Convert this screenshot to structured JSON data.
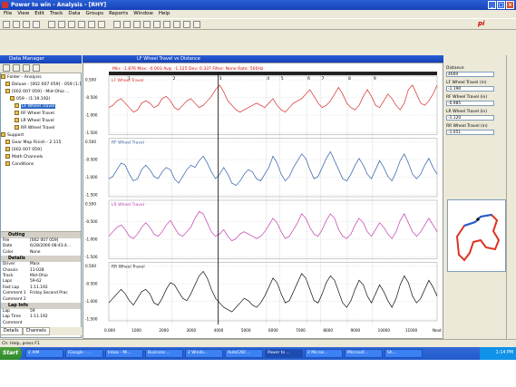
{
  "app": {
    "title": "Power to win - Analysis - [RHY]",
    "menu": [
      "File",
      "View",
      "Edit",
      "Track",
      "Data",
      "Groups",
      "Reports",
      "Window",
      "Help"
    ],
    "logo_text": "pi"
  },
  "data_manager": {
    "title": "Data Manager",
    "tree": [
      {
        "label": "Folder - Analysis",
        "indent": 0
      },
      {
        "label": "Deluxe - [002 007 059] - 059 (1:19.9...",
        "indent": 1
      },
      {
        "label": "[002 007 059] - Mid-Ohio ...",
        "indent": 1
      },
      {
        "label": "059 - (1:19.192)",
        "indent": 2
      },
      {
        "label": "LF Wheel Travel",
        "indent": 3,
        "selected": true
      },
      {
        "label": "RF Wheel Travel",
        "indent": 3
      },
      {
        "label": "LR Wheel Travel",
        "indent": 3
      },
      {
        "label": "RR Wheel Travel",
        "indent": 3
      },
      {
        "label": "Support",
        "indent": 0
      },
      {
        "label": "Gear Map Finish - 2.115",
        "indent": 1
      },
      {
        "label": "[002 007 059]",
        "indent": 1
      },
      {
        "label": "Math Channels",
        "indent": 1
      },
      {
        "label": "Conditions",
        "indent": 1
      }
    ],
    "sections": [
      {
        "title": "Outing",
        "rows": [
          {
            "k": "File",
            "v": "[002 007 059]"
          },
          {
            "k": "Date",
            "v": "6/28/2000 08:43:4..."
          },
          {
            "k": "Color",
            "v": "None"
          }
        ]
      },
      {
        "title": "Details",
        "rows": [
          {
            "k": "Driver",
            "v": "Marx"
          },
          {
            "k": "Chassis",
            "v": "11-028"
          },
          {
            "k": "Track",
            "v": "Mid-Ohio"
          },
          {
            "k": "Laps",
            "v": "59-62"
          },
          {
            "k": "Fast Lap",
            "v": "1:11.192"
          },
          {
            "k": "Comment 1",
            "v": "Friday Second Prac"
          },
          {
            "k": "Comment 2",
            "v": ""
          }
        ]
      },
      {
        "title": "Lap Info",
        "rows": [
          {
            "k": "Lap",
            "v": "59"
          },
          {
            "k": "Lap Time",
            "v": "1:11.192"
          },
          {
            "k": "Comment",
            "v": ""
          }
        ]
      }
    ],
    "tabs": [
      "Details",
      "Channels"
    ]
  },
  "chart_window": {
    "title": "LF Wheel Travel vs Distance",
    "stats_line": "Min: -1.876  Max: -0.003  Avg: -1.125  Dev: 0.337  Filter: None  Rate: 500Hz"
  },
  "chart_data": {
    "type": "line",
    "x_ticks": [
      "0.000",
      "1000",
      "2000",
      "3000",
      "4000",
      "5000",
      "6000",
      "7000",
      "8000",
      "9000",
      "10000",
      "11000",
      "Next"
    ],
    "xlim": [
      0,
      11700
    ],
    "segment_markers": [
      "1",
      "2",
      "3",
      "4",
      "5",
      "6",
      "7",
      "8",
      "9"
    ],
    "segment_positions": [
      650,
      2250,
      3900,
      5600,
      6100,
      7050,
      7550,
      8500,
      9400
    ],
    "cursor_x": 3900,
    "panels": [
      {
        "label": "LF Wheel Travel",
        "color": "#d62b2b",
        "ticks": [
          "0.500",
          "-0.500",
          "-1.000",
          "-1.500"
        ],
        "ylim": [
          -1.6,
          -0.3
        ],
        "values": [
          -1.0,
          -0.95,
          -0.85,
          -0.8,
          -0.9,
          -1.0,
          -1.1,
          -1.05,
          -0.9,
          -0.85,
          -0.9,
          -1.0,
          -0.95,
          -0.8,
          -0.75,
          -0.85,
          -1.0,
          -1.05,
          -0.95,
          -0.85,
          -0.8,
          -0.9,
          -1.0,
          -0.95,
          -0.85,
          -0.75,
          -0.6,
          -0.5,
          -0.65,
          -0.85,
          -0.95,
          -1.05,
          -1.1,
          -1.05,
          -1.0,
          -0.95,
          -0.9,
          -0.95,
          -1.0,
          -0.9,
          -0.8,
          -0.95,
          -1.05,
          -1.1,
          -1.0,
          -0.9,
          -0.85,
          -0.8,
          -0.7,
          -0.6,
          -0.75,
          -0.9,
          -1.0,
          -0.95,
          -0.85,
          -0.7,
          -0.55,
          -0.7,
          -0.9,
          -1.0,
          -1.05,
          -0.95,
          -0.75,
          -0.6,
          -0.75,
          -0.95,
          -1.0,
          -0.85,
          -0.7,
          -0.8,
          -0.95,
          -1.05,
          -0.9,
          -0.6,
          -0.5,
          -0.7,
          -0.9,
          -0.95,
          -0.85,
          -0.7,
          -0.5
        ]
      },
      {
        "label": "RF Wheel Travel",
        "color": "#2f5fa8",
        "ticks": [
          "0.500",
          "-0.500",
          "-1.000",
          "-1.500"
        ],
        "ylim": [
          -1.6,
          -0.3
        ],
        "values": [
          -1.2,
          -1.15,
          -1.0,
          -0.85,
          -0.9,
          -1.1,
          -1.25,
          -1.2,
          -1.0,
          -0.9,
          -1.0,
          -1.15,
          -1.2,
          -1.05,
          -0.95,
          -1.0,
          -1.2,
          -1.3,
          -1.15,
          -1.0,
          -0.9,
          -0.95,
          -0.8,
          -0.7,
          -0.85,
          -1.05,
          -1.2,
          -1.1,
          -0.95,
          -1.1,
          -1.3,
          -1.35,
          -1.25,
          -1.1,
          -1.0,
          -1.05,
          -1.2,
          -1.25,
          -1.1,
          -0.95,
          -0.7,
          -0.85,
          -1.1,
          -1.25,
          -1.15,
          -0.95,
          -0.8,
          -0.65,
          -0.75,
          -1.0,
          -1.2,
          -1.15,
          -0.95,
          -0.75,
          -0.6,
          -0.8,
          -1.0,
          -1.2,
          -1.25,
          -1.1,
          -0.9,
          -0.75,
          -0.9,
          -1.1,
          -1.2,
          -1.0,
          -0.8,
          -0.95,
          -1.15,
          -1.25,
          -1.05,
          -0.8,
          -0.65,
          -0.85,
          -1.1,
          -1.2,
          -1.1,
          -0.9,
          -0.75,
          -0.95,
          -1.1
        ]
      },
      {
        "label": "LR Wheel Travel",
        "color": "#c03bb0",
        "ticks": [
          "0.500",
          "-0.500",
          "-1.000",
          "-1.500"
        ],
        "ylim": [
          -1.6,
          -0.3
        ],
        "values": [
          -1.1,
          -1.0,
          -0.9,
          -0.85,
          -0.95,
          -1.1,
          -1.15,
          -1.05,
          -0.9,
          -0.8,
          -0.9,
          -1.05,
          -1.1,
          -1.0,
          -0.85,
          -0.75,
          -0.9,
          -1.05,
          -1.1,
          -1.0,
          -0.9,
          -0.7,
          -0.55,
          -0.6,
          -0.8,
          -1.0,
          -1.1,
          -1.05,
          -0.95,
          -1.1,
          -1.2,
          -1.15,
          -1.05,
          -1.0,
          -1.05,
          -1.1,
          -1.15,
          -1.1,
          -1.0,
          -0.85,
          -0.7,
          -0.8,
          -1.0,
          -1.15,
          -1.1,
          -0.95,
          -0.8,
          -0.6,
          -0.7,
          -0.9,
          -1.05,
          -1.1,
          -0.95,
          -0.75,
          -0.6,
          -0.7,
          -0.95,
          -1.1,
          -1.15,
          -1.05,
          -0.85,
          -0.7,
          -0.8,
          -1.0,
          -1.1,
          -0.95,
          -0.8,
          -0.9,
          -1.05,
          -1.15,
          -1.0,
          -0.75,
          -0.6,
          -0.8,
          -1.0,
          -1.1,
          -1.0,
          -0.85,
          -0.7,
          -0.85,
          -1.0
        ]
      },
      {
        "label": "RR Wheel Travel",
        "color": "#111111",
        "ticks": [
          "0.500",
          "-0.500",
          "-1.000",
          "-1.500"
        ],
        "ylim": [
          -1.6,
          -0.3
        ],
        "values": [
          -1.2,
          -1.1,
          -1.0,
          -0.9,
          -1.0,
          -1.15,
          -1.25,
          -1.1,
          -0.95,
          -0.9,
          -1.0,
          -1.2,
          -1.25,
          -1.1,
          -0.9,
          -0.75,
          -0.8,
          -0.95,
          -1.1,
          -1.15,
          -1.0,
          -0.8,
          -0.6,
          -0.5,
          -0.65,
          -0.9,
          -1.1,
          -1.2,
          -1.3,
          -1.35,
          -1.4,
          -1.3,
          -1.2,
          -1.1,
          -1.15,
          -1.25,
          -1.3,
          -1.2,
          -1.05,
          -0.85,
          -0.65,
          -0.75,
          -1.0,
          -1.2,
          -1.15,
          -0.95,
          -0.75,
          -0.55,
          -0.65,
          -0.9,
          -1.15,
          -1.2,
          -1.0,
          -0.75,
          -0.6,
          -0.7,
          -0.95,
          -1.2,
          -1.3,
          -1.15,
          -0.9,
          -0.7,
          -0.8,
          -1.05,
          -1.2,
          -1.0,
          -0.8,
          -0.95,
          -1.15,
          -1.3,
          -1.1,
          -0.8,
          -0.6,
          -0.75,
          -1.05,
          -1.2,
          -1.1,
          -0.9,
          -0.7,
          -0.85,
          -1.05
        ]
      }
    ]
  },
  "right_panel": {
    "fields": [
      {
        "label": "Distance",
        "value": "4669"
      },
      {
        "label": "LF Wheel Travel (in)",
        "value": "-1.190"
      },
      {
        "label": "RF Wheel Travel (in)",
        "value": "-0.985"
      },
      {
        "label": "LR Wheel Travel (in)",
        "value": "-1.120"
      },
      {
        "label": "RR Wheel Travel (in)",
        "value": "-1.051"
      }
    ]
  },
  "status_bar": {
    "text": "Ch: Help, press F1"
  },
  "taskbar": {
    "start": "Start",
    "tasks": [
      "2 AIM",
      "iGoogle - ...",
      "Inbox - Mi...",
      "Business ...",
      "2 Windo...",
      "AutoCAD ...",
      "Power to ...",
      "2 Micros...",
      "Microsof...",
      "Sh..."
    ],
    "clock": "1:14 PM"
  },
  "colors": {
    "accent": "#1541b8",
    "selection": "#316ac5"
  }
}
